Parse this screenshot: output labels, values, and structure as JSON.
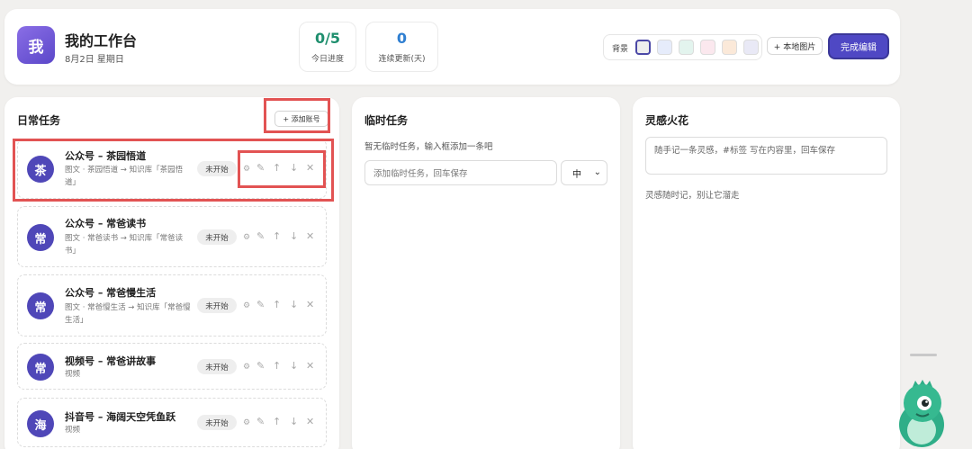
{
  "header": {
    "avatar_char": "我",
    "title": "我的工作台",
    "date": "8月2日 星期日",
    "stats": [
      {
        "value": "0/5",
        "label": "今日进度",
        "color": "#1f8f6e"
      },
      {
        "value": "0",
        "label": "连续更新(天)",
        "color": "#2f7fd1"
      }
    ],
    "background_label": "背景",
    "swatches": [
      "#eeeeee",
      "#e6ecfb",
      "#e3f4ee",
      "#fbe8ee",
      "#fbe9d9",
      "#e9e9f6"
    ],
    "local_image_label": "+ 本地图片",
    "done_label": "完成编辑"
  },
  "daily": {
    "title": "日常任务",
    "add_label": "+ 添加账号",
    "status_color": "#4f47b8",
    "tasks": [
      {
        "avatar": "茶",
        "title": "公众号 – 茶园悟道",
        "subtitle": "图文 · 茶园悟道 → 知识库「茶园悟道」",
        "status": "未开始"
      },
      {
        "avatar": "常",
        "title": "公众号 – 常爸读书",
        "subtitle": "图文 · 常爸读书 → 知识库「常爸读书」",
        "status": "未开始"
      },
      {
        "avatar": "常",
        "title": "公众号 – 常爸慢生活",
        "subtitle": "图文 · 常爸慢生活 → 知识库「常爸慢生活」",
        "status": "未开始"
      },
      {
        "avatar": "常",
        "title": "视频号 – 常爸讲故事",
        "subtitle": "视频",
        "status": "未开始"
      },
      {
        "avatar": "海",
        "title": "抖音号 – 海阔天空凭鱼跃",
        "subtitle": "视频",
        "status": "未开始"
      }
    ]
  },
  "temp": {
    "title": "临时任务",
    "hint": "暂无临时任务，输入框添加一条吧",
    "input_placeholder": "添加临时任务，回车保存",
    "priority": "中"
  },
  "inspiration": {
    "title": "灵感火花",
    "placeholder": "随手记一条灵感，#标签 写在内容里，回车保存",
    "note": "灵感随时记，别让它溜走"
  },
  "icons": {
    "gear": "⚙",
    "edit": "✎",
    "up": "↑",
    "down": "↓",
    "close": "✕",
    "chevron": "⌄"
  }
}
